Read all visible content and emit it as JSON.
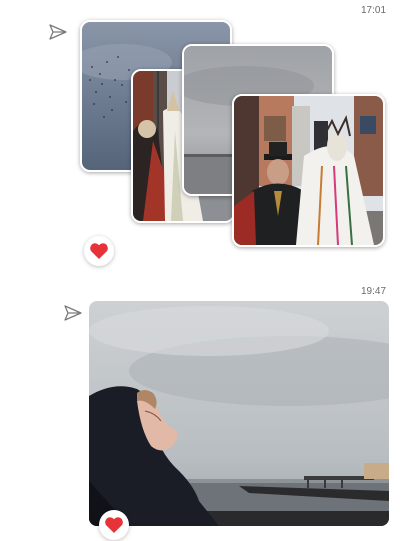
{
  "messages": [
    {
      "time": "17:01",
      "status_icon": "sent-arrow-icon",
      "reaction_icon": "heart-icon",
      "photos": [
        "sky-with-birds-photo",
        "pier-street-photo",
        "grey-sky-photo",
        "folk-dancers-photo"
      ]
    },
    {
      "time": "19:47",
      "status_icon": "sent-arrow-icon",
      "reaction_icon": "heart-icon",
      "photos": [
        "hooded-person-seaside-photo"
      ]
    }
  ],
  "colors": {
    "heart": "#e8323a",
    "timestamp": "#6b6b6b",
    "icon_stroke": "#7a7a7a"
  }
}
